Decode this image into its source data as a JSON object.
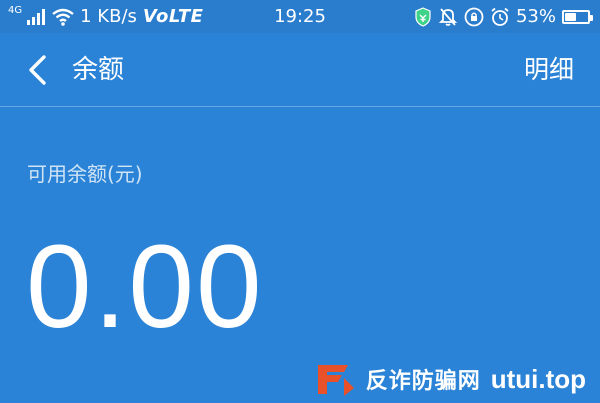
{
  "status_bar": {
    "network_type": "4G",
    "speed": "1 KB/s",
    "volte": "VoLTE",
    "time": "19:25",
    "battery_percent": "53%",
    "battery_level": 0.53
  },
  "app_bar": {
    "title": "余额",
    "detail_label": "明细"
  },
  "balance": {
    "label": "可用余额(元)",
    "amount": "0.00"
  },
  "watermark": {
    "text": "反诈防骗网",
    "domain": "utui.top"
  },
  "colors": {
    "background": "#2a83d6",
    "status_bar": "#2a7ccd",
    "text": "#ffffff",
    "watermark_accent": "#e8512a"
  }
}
